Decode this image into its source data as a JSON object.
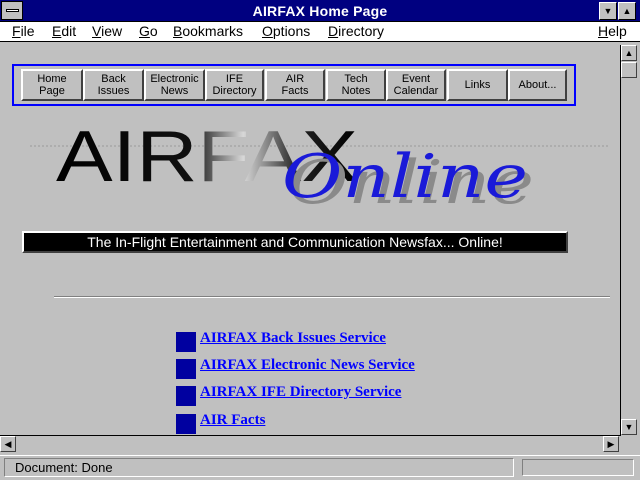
{
  "window": {
    "title": "AIRFAX Home Page"
  },
  "menu": {
    "file": "File",
    "edit": "Edit",
    "view": "View",
    "go": "Go",
    "bookmarks": "Bookmarks",
    "options": "Options",
    "directory": "Directory",
    "help": "Help"
  },
  "nav": {
    "home": [
      "Home",
      "Page"
    ],
    "back_issues": [
      "Back",
      "Issues"
    ],
    "electronic_news": [
      "Electronic",
      "News"
    ],
    "ife_directory": [
      "IFE",
      "Directory"
    ],
    "air_facts": [
      "AIR",
      "Facts"
    ],
    "tech_notes": [
      "Tech",
      "Notes"
    ],
    "event_calendar": [
      "Event",
      "Calendar"
    ],
    "links": "Links",
    "about": "About..."
  },
  "logo": {
    "main": "AIRFAX",
    "script": "Online"
  },
  "banner": "The In-Flight Entertainment and Communication Newsfax... Online!",
  "links": [
    "AIRFAX Back Issues Service",
    "AIRFAX Electronic News Service",
    "AIRFAX IFE Directory Service",
    "AIR Facts"
  ],
  "status": {
    "text": "Document: Done"
  },
  "colors": {
    "title_bar": "#000080",
    "link": "#0000ff",
    "nav_border": "#0000ff",
    "bullet": "#0000a0"
  }
}
